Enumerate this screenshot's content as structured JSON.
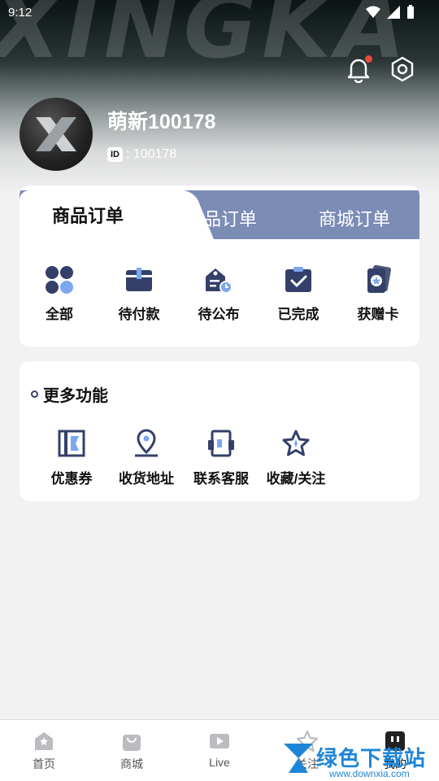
{
  "status_bar": {
    "time": "9:12"
  },
  "hero": {
    "brand_text": "XINGKA"
  },
  "profile": {
    "nickname": "萌新100178",
    "id_chip": "ID",
    "id_value": ": 100178"
  },
  "orders": {
    "tabs": [
      {
        "label": "商品订单",
        "active": true
      },
      {
        "label": "赠品订单",
        "active": false
      },
      {
        "label": "商城订单",
        "active": false
      }
    ],
    "items": [
      {
        "label": "全部",
        "icon": "grid-icon"
      },
      {
        "label": "待付款",
        "icon": "wallet-icon"
      },
      {
        "label": "待公布",
        "icon": "pending-tag-icon"
      },
      {
        "label": "已完成",
        "icon": "check-clipboard-icon"
      },
      {
        "label": "获赠卡",
        "icon": "card-icon"
      }
    ]
  },
  "more": {
    "title": "更多功能",
    "items": [
      {
        "label": "优惠券",
        "icon": "coupon-icon"
      },
      {
        "label": "收货地址",
        "icon": "location-icon"
      },
      {
        "label": "联系客服",
        "icon": "headset-icon"
      },
      {
        "label": "收藏/关注",
        "icon": "star-icon"
      }
    ]
  },
  "nav": {
    "items": [
      {
        "label": "首页",
        "icon": "home-icon"
      },
      {
        "label": "商城",
        "icon": "bag-icon"
      },
      {
        "label": "Live",
        "icon": "play-icon"
      },
      {
        "label": "关注",
        "icon": "star-outline-icon"
      },
      {
        "label": "我的",
        "icon": "profile-icon",
        "active": true
      }
    ]
  },
  "watermark": {
    "text": "绿色下载站",
    "url": "www.downxia.com"
  },
  "colors": {
    "accent": "#7b8cb5",
    "badge": "#e84a3b",
    "icon_dark": "#34406a",
    "icon_blue": "#7aa7f0"
  }
}
